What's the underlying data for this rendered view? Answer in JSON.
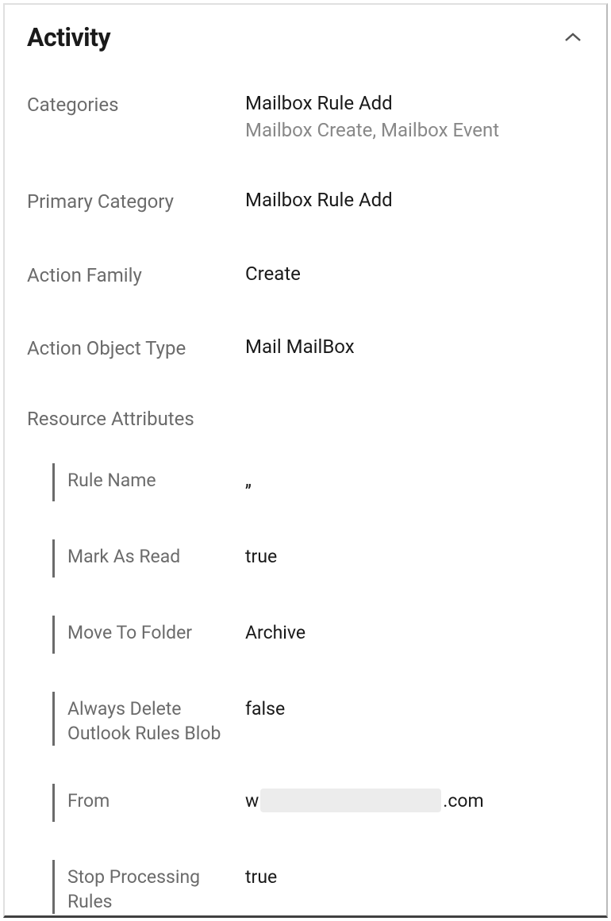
{
  "panel": {
    "title": "Activity",
    "fields": {
      "categories": {
        "label": "Categories",
        "value": "Mailbox Rule Add",
        "sub": "Mailbox Create, Mailbox Event"
      },
      "primary_category": {
        "label": "Primary Category",
        "value": "Mailbox Rule Add"
      },
      "action_family": {
        "label": "Action Family",
        "value": "Create"
      },
      "action_object_type": {
        "label": "Action Object Type",
        "value": "Mail MailBox"
      }
    },
    "resource_attributes": {
      "label": "Resource Attributes",
      "items": [
        {
          "label": "Rule Name",
          "value": "„"
        },
        {
          "label": "Mark As Read",
          "value": "true"
        },
        {
          "label": "Move To Folder",
          "value": "Archive"
        },
        {
          "label": "Always Delete Outlook Rules Blob",
          "value": "false"
        },
        {
          "label": "From",
          "value_prefix": "w",
          "value_suffix": ".com",
          "redacted": true
        },
        {
          "label": "Stop Processing Rules",
          "value": "true"
        }
      ]
    }
  }
}
